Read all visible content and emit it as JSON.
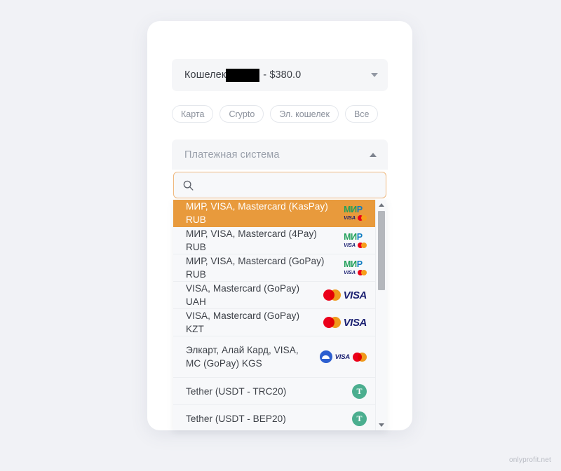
{
  "page": {
    "background_color": "#f1f2f6",
    "watermark": "onlyprofit.net"
  },
  "card": {
    "background_color": "#ffffff"
  },
  "wallet_select": {
    "name": "wallet-select",
    "label_prefix": "Кошелек",
    "redacted": true,
    "label_suffix": "- $380.0",
    "caret": "chevron-down-icon"
  },
  "filters": {
    "chips": [
      {
        "label": "Карта"
      },
      {
        "label": "Crypto"
      },
      {
        "label": "Эл. кошелек"
      },
      {
        "label": "Все"
      }
    ]
  },
  "payment_system_select": {
    "placeholder": "Платежная система",
    "expanded": true,
    "caret": "chevron-up-icon"
  },
  "search": {
    "value": "",
    "placeholder": "",
    "icon": "search-icon",
    "border_color": "#efb980"
  },
  "dropdown": {
    "selected_index": 0,
    "selected_color": "#e89a3c",
    "items": [
      {
        "label": "МИР, VISA, Mastercard (KasPay) RUB",
        "logos": "mir-visa-mc",
        "selected": true
      },
      {
        "label": "МИР, VISA, Mastercard (4Pay) RUB",
        "logos": "mir-visa-mc",
        "selected": false
      },
      {
        "label": "МИР, VISA, Mastercard (GoPay) RUB",
        "logos": "mir-visa-mc",
        "selected": false
      },
      {
        "label": "VISA, Mastercard (GoPay) UAH",
        "logos": "mc-visa",
        "selected": false
      },
      {
        "label": "VISA, Mastercard (GoPay) KZT",
        "logos": "mc-visa",
        "selected": false
      },
      {
        "label": "Элкарт, Алай Кард, VISA, MC (GoPay) KGS",
        "logos": "elcart-visa-mc",
        "selected": false,
        "tall": true
      },
      {
        "label": "Tether (USDT - TRC20)",
        "logos": "tether",
        "selected": false
      },
      {
        "label": "Tether (USDT - BEP20)",
        "logos": "tether",
        "selected": false
      }
    ],
    "scrollbar": {
      "up_arrow": "scroll-up-arrow-icon",
      "down_arrow": "scroll-down-arrow-icon"
    }
  }
}
